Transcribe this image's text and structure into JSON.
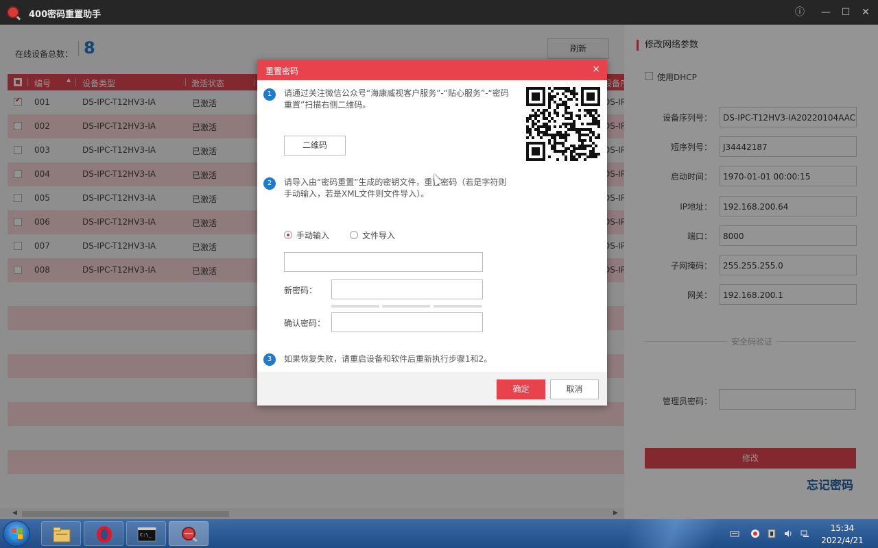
{
  "app": {
    "title": "400密码重置助手"
  },
  "main": {
    "online_label": "在线设备总数：",
    "online_count": "8",
    "refresh_label": "刷新",
    "table": {
      "headers": [
        "编号",
        "设备类型",
        "激活状态",
        "设备序"
      ],
      "rows": [
        {
          "id": "001",
          "type": "DS-IPC-T12HV3-IA",
          "status": "已激活",
          "extra": "DS-IP",
          "checked": true
        },
        {
          "id": "002",
          "type": "DS-IPC-T12HV3-IA",
          "status": "已激活",
          "extra": "DS-IP",
          "checked": false
        },
        {
          "id": "003",
          "type": "DS-IPC-T12HV3-IA",
          "status": "已激活",
          "extra": "DS-IP",
          "checked": false
        },
        {
          "id": "004",
          "type": "DS-IPC-T12HV3-IA",
          "status": "已激活",
          "extra": "DS-IP",
          "checked": false
        },
        {
          "id": "005",
          "type": "DS-IPC-T12HV3-IA",
          "status": "已激活",
          "extra": "DS-IP",
          "checked": false
        },
        {
          "id": "006",
          "type": "DS-IPC-T12HV3-IA",
          "status": "已激活",
          "extra": "DS-IP",
          "checked": false
        },
        {
          "id": "007",
          "type": "DS-IPC-T12HV3-IA",
          "status": "已激活",
          "extra": "DS-IP",
          "checked": false
        },
        {
          "id": "008",
          "type": "DS-IPC-T12HV3-IA",
          "status": "已激活",
          "extra": "DS-IP",
          "checked": false
        }
      ]
    }
  },
  "panel": {
    "title": "修改网络参数",
    "dhcp_label": "使用DHCP",
    "fields": [
      {
        "label": "设备序列号：",
        "value": "DS-IPC-T12HV3-IA20220104AACH"
      },
      {
        "label": "短序列号：",
        "value": "J34442187"
      },
      {
        "label": "启动时间：",
        "value": "1970-01-01 00:00:15"
      },
      {
        "label": "IP地址：",
        "value": "192.168.200.64"
      },
      {
        "label": "端口：",
        "value": "8000"
      },
      {
        "label": "子网掩码：",
        "value": "255.255.255.0"
      },
      {
        "label": "网关：",
        "value": "192.168.200.1"
      }
    ],
    "security_label": "安全码验证",
    "admin_pwd_label": "管理员密码：",
    "modify_label": "修改",
    "forgot_label": "忘记密码"
  },
  "modal": {
    "title": "重置密码",
    "close": "×",
    "step1_num": "1",
    "step1_text": "请通过关注微信公众号“海康威视客户服务”-“贴心服务”-“密码重置”扫描右侧二维码。",
    "qr_button": "二维码",
    "step2_num": "2",
    "step2_text": "请导入由“密码重置”生成的密钥文件，重置密码（若是字符则手动输入，若是XML文件则文件导入）。",
    "radio_manual": "手动输入",
    "radio_file": "文件导入",
    "new_pwd_label": "新密码：",
    "confirm_pwd_label": "确认密码：",
    "step3_num": "3",
    "step3_text": "如果恢复失败，请重启设备和软件后重新执行步骤1和2。",
    "ok_label": "确定",
    "cancel_label": "取消"
  },
  "taskbar": {
    "time": "15:34",
    "date": "2022/4/21"
  },
  "colors": {
    "accent": "#e24650",
    "link": "#1f5fa8",
    "count": "#1f7acb"
  }
}
